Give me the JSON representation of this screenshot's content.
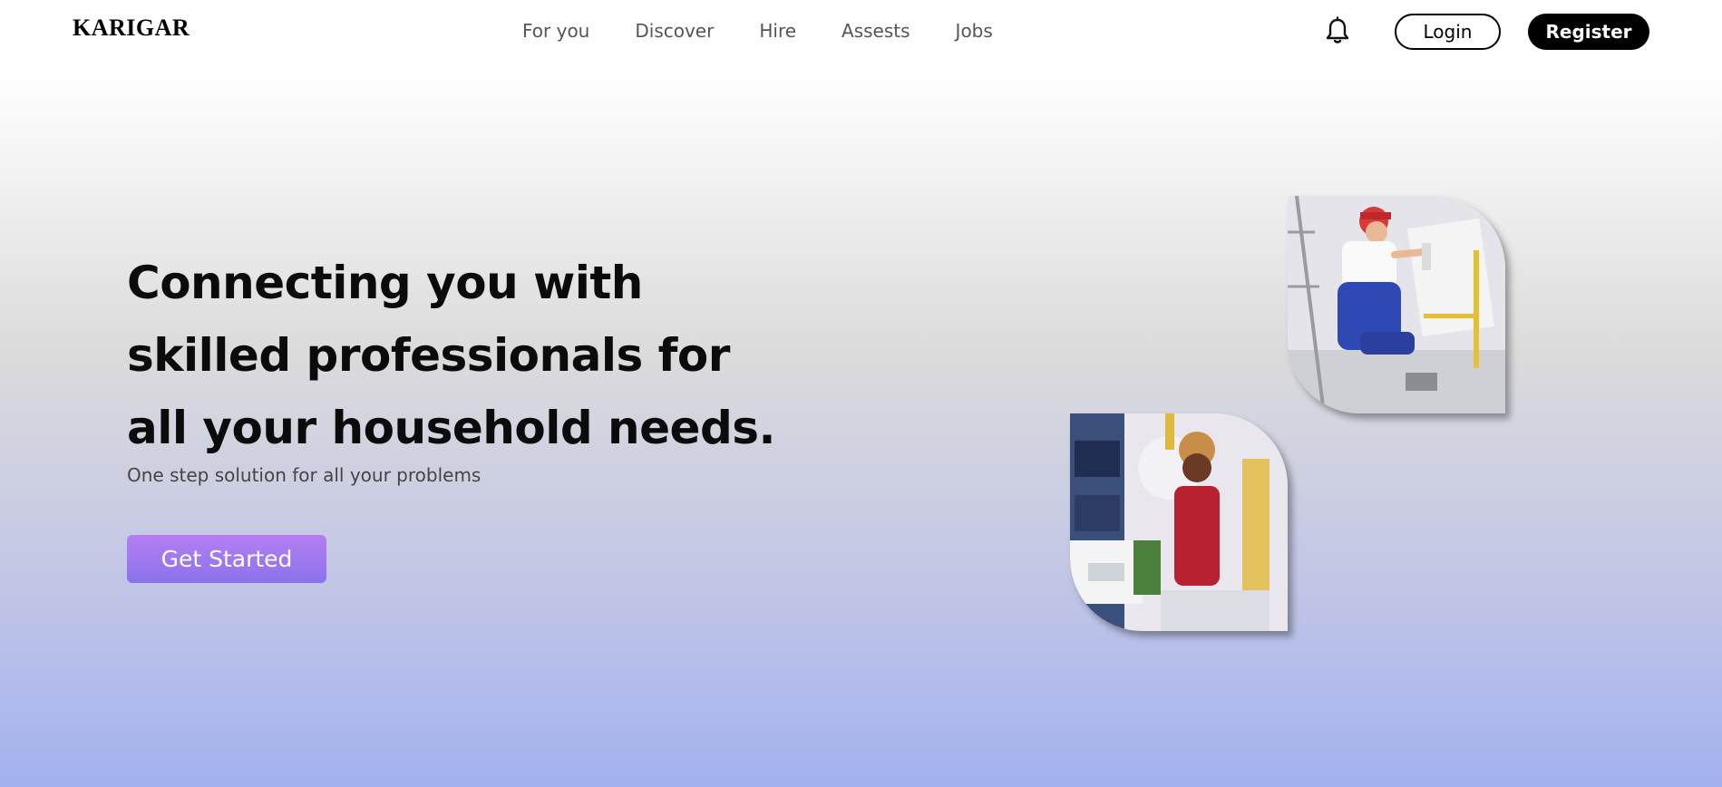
{
  "brand": {
    "name": "KARIGAR"
  },
  "nav": {
    "links": [
      "For you",
      "Discover",
      "Hire",
      "Assests",
      "Jobs"
    ]
  },
  "header": {
    "notification_icon": "bell-icon",
    "login_label": "Login",
    "register_label": "Register"
  },
  "hero": {
    "title": "Connecting you with skilled professionals for all your household needs.",
    "subtitle": "One step solution for all your problems",
    "cta_label": "Get Started"
  },
  "colors": {
    "cta_gradient_start": "#b57ef2",
    "cta_gradient_end": "#8b72ec",
    "register_bg": "#000000",
    "background_bottom": "#a3b1f0"
  }
}
